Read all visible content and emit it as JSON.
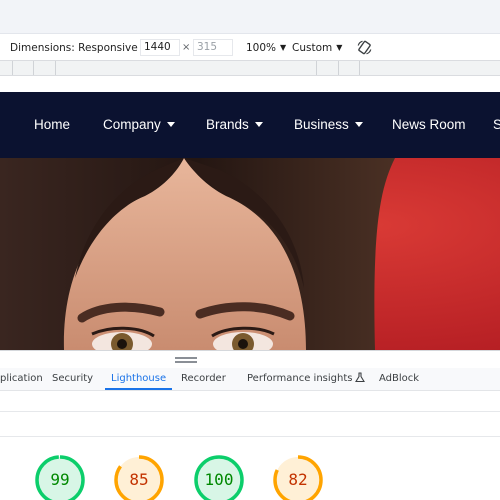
{
  "device_toolbar": {
    "dimensions_label": "Dimensions: Responsive",
    "width_value": "1440",
    "times_sign": "×",
    "height_value": "315",
    "zoom_label": "100%",
    "throttle_label": "Custom"
  },
  "site_nav": {
    "items": [
      {
        "label": "Home",
        "has_caret": false
      },
      {
        "label": "Company",
        "has_caret": true
      },
      {
        "label": "Brands",
        "has_caret": true
      },
      {
        "label": "Business",
        "has_caret": true
      },
      {
        "label": "News Room",
        "has_caret": false
      },
      {
        "label": "S",
        "has_caret": false
      }
    ],
    "background": "#0b1230"
  },
  "hero": {
    "background": "#c6262a"
  },
  "devtools_tabs": {
    "items": [
      {
        "label": "plication"
      },
      {
        "label": "Security"
      },
      {
        "label": "Lighthouse",
        "active": true
      },
      {
        "label": "Recorder"
      },
      {
        "label": "Performance insights"
      },
      {
        "label": "AdBlock"
      }
    ],
    "accent": "#1a73e8"
  },
  "lighthouse": {
    "scores": [
      {
        "value": "99",
        "fraction": 0.99,
        "color": "#0cce6b",
        "track": "#d8f6e6",
        "text_color": "#008800"
      },
      {
        "value": "85",
        "fraction": 0.85,
        "color": "#ffa400",
        "track": "#fff0d6",
        "text_color": "#c33300"
      },
      {
        "value": "100",
        "fraction": 1.0,
        "color": "#0cce6b",
        "track": "#d8f6e6",
        "text_color": "#008800"
      },
      {
        "value": "82",
        "fraction": 0.82,
        "color": "#ffa400",
        "track": "#fff0d6",
        "text_color": "#c33300"
      }
    ]
  }
}
